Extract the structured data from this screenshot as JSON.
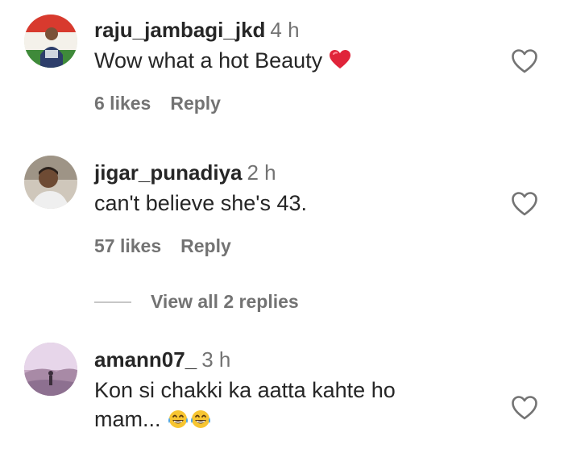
{
  "comments": [
    {
      "username": "raju_jambagi_jkd",
      "time": "4 h",
      "text": "Wow what a hot Beauty",
      "emoji": "red-heart",
      "likes": "6 likes",
      "reply_label": "Reply"
    },
    {
      "username": "jigar_punadiya",
      "time": "2 h",
      "text": "can't believe she's 43.",
      "likes": "57 likes",
      "reply_label": "Reply"
    },
    {
      "username": "amann07_",
      "time": "3 h",
      "text": "Kon si chakki ka aatta kahte ho mam...",
      "emoji": "face-with-tears-of-joy",
      "emoji_count": 2
    }
  ],
  "view_replies": {
    "label": "View all 2 replies"
  },
  "icons": {
    "like": "heart-outline-icon"
  },
  "colors": {
    "primary_text": "#262626",
    "secondary_text": "#737373",
    "divider": "#c7c7c7",
    "emoji_heart": "#e0243a"
  }
}
